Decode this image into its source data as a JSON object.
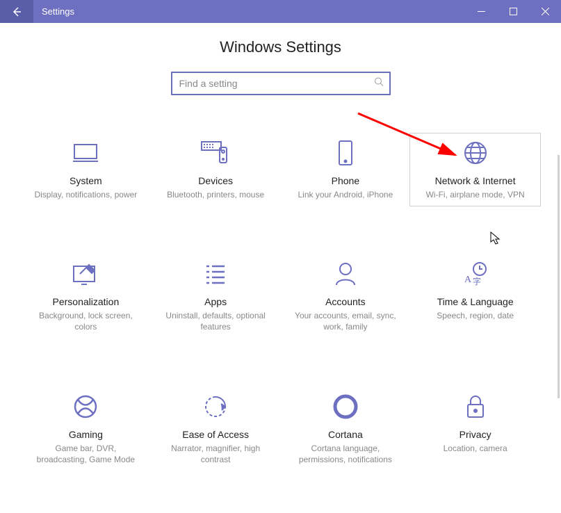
{
  "window": {
    "title": "Settings"
  },
  "page": {
    "heading": "Windows Settings"
  },
  "search": {
    "placeholder": "Find a setting"
  },
  "tiles": [
    {
      "id": "system",
      "title": "System",
      "desc": "Display, notifications, power"
    },
    {
      "id": "devices",
      "title": "Devices",
      "desc": "Bluetooth, printers, mouse"
    },
    {
      "id": "phone",
      "title": "Phone",
      "desc": "Link your Android, iPhone"
    },
    {
      "id": "network",
      "title": "Network & Internet",
      "desc": "Wi-Fi, airplane mode, VPN",
      "hovered": true
    },
    {
      "id": "personalization",
      "title": "Personalization",
      "desc": "Background, lock screen, colors"
    },
    {
      "id": "apps",
      "title": "Apps",
      "desc": "Uninstall, defaults, optional features"
    },
    {
      "id": "accounts",
      "title": "Accounts",
      "desc": "Your accounts, email, sync, work, family"
    },
    {
      "id": "timelang",
      "title": "Time & Language",
      "desc": "Speech, region, date"
    },
    {
      "id": "gaming",
      "title": "Gaming",
      "desc": "Game bar, DVR, broadcasting, Game Mode"
    },
    {
      "id": "ease",
      "title": "Ease of Access",
      "desc": "Narrator, magnifier, high contrast"
    },
    {
      "id": "cortana",
      "title": "Cortana",
      "desc": "Cortana language, permissions, notifications"
    },
    {
      "id": "privacy",
      "title": "Privacy",
      "desc": "Location, camera"
    }
  ],
  "colors": {
    "accent": "#6d6fc1"
  }
}
